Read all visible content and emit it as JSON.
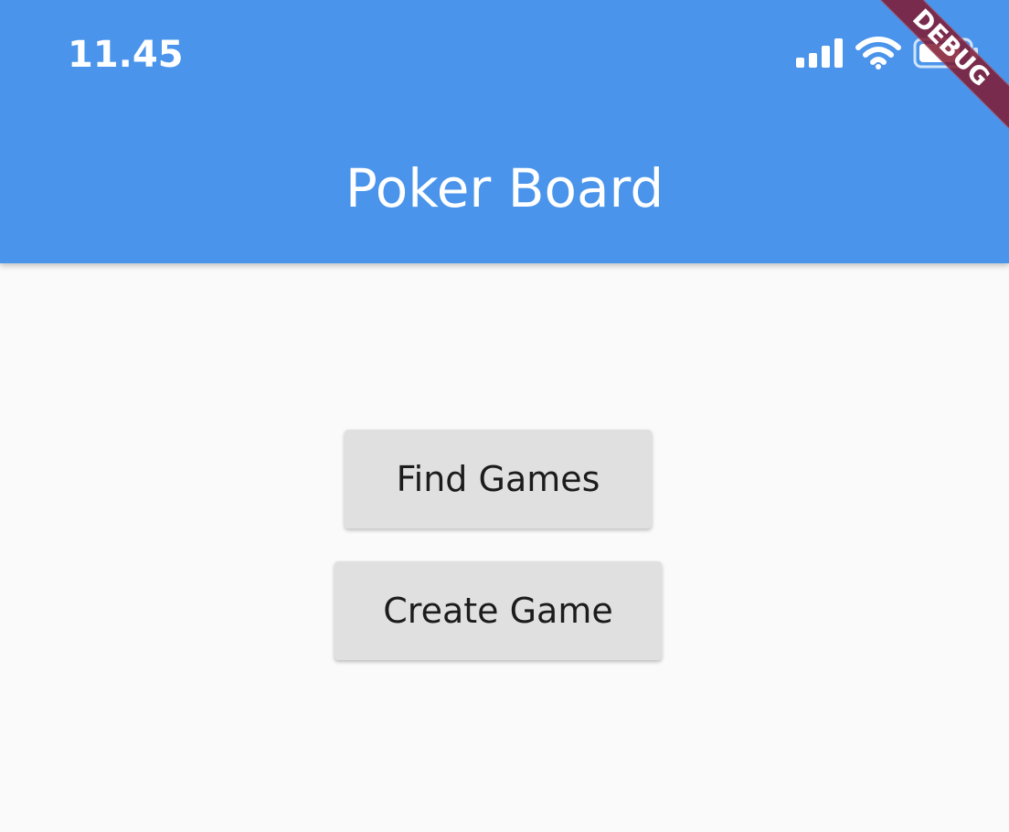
{
  "status_bar": {
    "time": "11.45",
    "icons": [
      "signal-icon",
      "wifi-icon",
      "battery-icon"
    ]
  },
  "app_bar": {
    "title": "Poker Board",
    "background_color": "#4a94eb"
  },
  "debug_banner": {
    "label": "DEBUG"
  },
  "actions": {
    "find_games_label": "Find Games",
    "create_game_label": "Create Game",
    "button_color": "#e0e0e0"
  }
}
